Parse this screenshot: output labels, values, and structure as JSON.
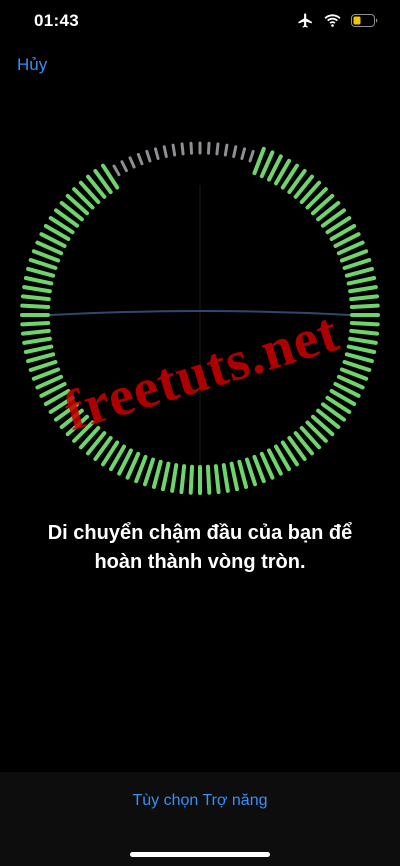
{
  "status_bar": {
    "time": "01:43",
    "icons": [
      "airplane-icon",
      "wifi-icon",
      "battery-icon"
    ],
    "battery_color": "#f5c400"
  },
  "nav": {
    "cancel_label": "Hủy"
  },
  "ring": {
    "total_ticks": 120,
    "completed_color": "#6fd46c",
    "pending_color": "#8e8e93",
    "pending_arc_degrees": [
      -30,
      20
    ]
  },
  "watermark": {
    "text": "freetuts.net",
    "color": "#cc0000"
  },
  "instruction": {
    "line1": "Di chuyển chậm đầu của bạn để",
    "line2": "hoàn thành vòng tròn."
  },
  "footer": {
    "accessibility_options_label": "Tùy chọn Trợ năng"
  },
  "colors": {
    "accent": "#3a8ef7",
    "background": "#000000"
  }
}
